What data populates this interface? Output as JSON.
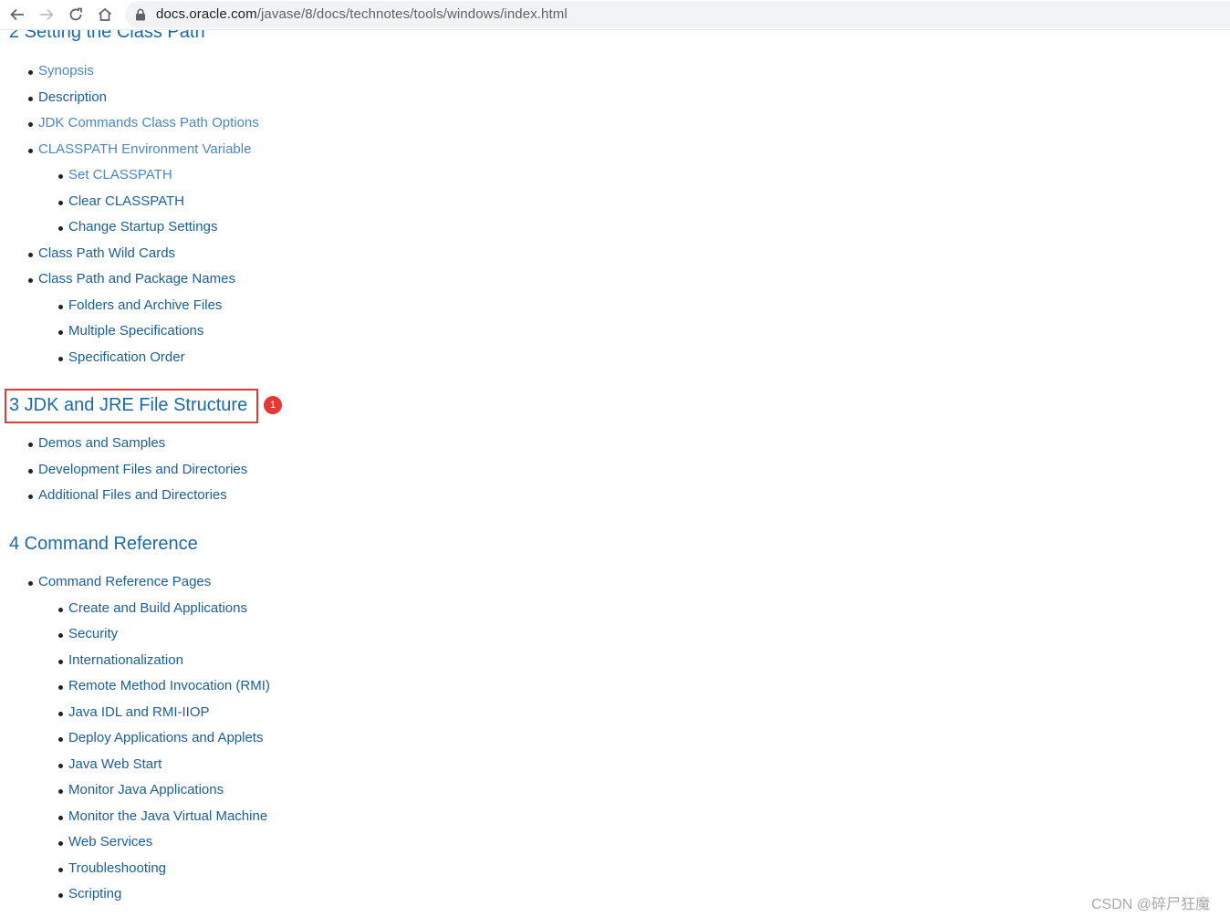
{
  "browser": {
    "url_host": "docs.oracle.com",
    "url_path": "/javase/8/docs/technotes/tools/windows/index.html",
    "back_icon": "arrow-left-icon",
    "forward_icon": "arrow-right-icon",
    "reload_icon": "reload-icon",
    "home_icon": "home-icon",
    "lock_icon": "lock-icon"
  },
  "section2": {
    "title": "2 Setting the Class Path",
    "items": [
      "Synopsis",
      "Description",
      "JDK Commands Class Path Options",
      "CLASSPATH Environment Variable",
      "Set CLASSPATH",
      "Clear CLASSPATH",
      "Change Startup Settings",
      "Class Path Wild Cards",
      "Class Path and Package Names",
      "Folders and Archive Files",
      "Multiple Specifications",
      "Specification Order"
    ]
  },
  "section3": {
    "title": "3 JDK and JRE File Structure",
    "badge": "1",
    "items": [
      "Demos and Samples",
      "Development Files and Directories",
      "Additional Files and Directories"
    ]
  },
  "section4": {
    "title": "4 Command Reference",
    "items": [
      "Command Reference Pages",
      "Create and Build Applications",
      "Security",
      "Internationalization",
      "Remote Method Invocation (RMI)",
      "Java IDL and RMI-IIOP",
      "Deploy Applications and Applets",
      "Java Web Start",
      "Monitor Java Applications",
      "Monitor the Java Virtual Machine",
      "Web Services",
      "Troubleshooting",
      "Scripting"
    ]
  },
  "colors": {
    "link": "#1a5e9a",
    "visited_link": "#4a86c6",
    "heading": "#1a6aa8",
    "highlight": "#e03b3b"
  },
  "watermark": "CSDN @碎尸狂魔"
}
